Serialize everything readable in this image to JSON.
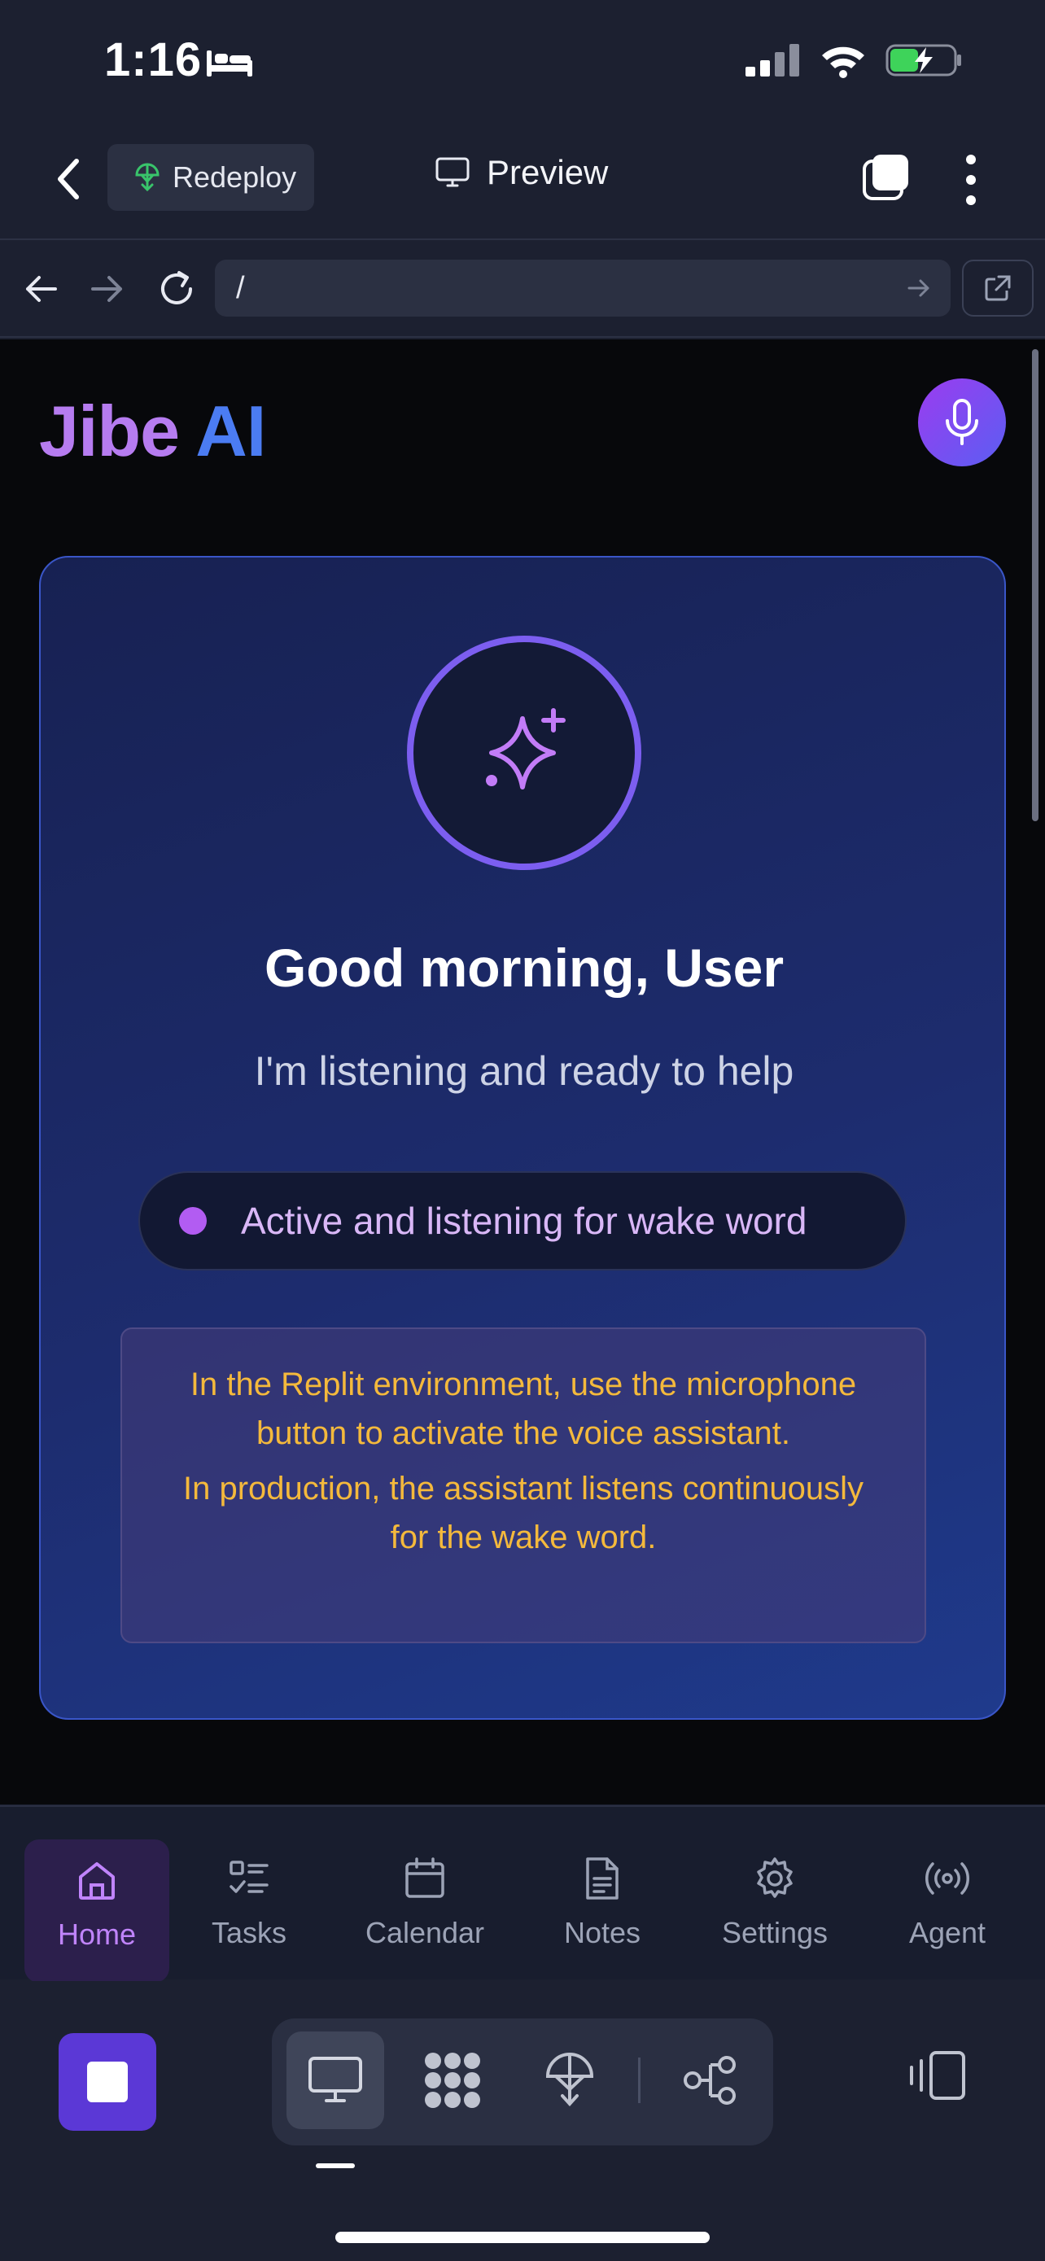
{
  "status_bar": {
    "time": "1:16"
  },
  "top_nav": {
    "redeploy_label": "Redeploy",
    "title": "Preview"
  },
  "url_bar": {
    "path": "/"
  },
  "app": {
    "logo_part1": "Jibe",
    "logo_part2": "AI",
    "greeting": "Good morning, User",
    "subtitle": "I'm listening and ready to help",
    "status_text": "Active and listening for wake word",
    "notice_line1": "In the Replit environment, use the microphone button to activate the voice assistant.",
    "notice_line2": "In production, the assistant listens continuously for the wake word."
  },
  "tabs": [
    {
      "label": "Home",
      "icon": "home-icon",
      "active": true
    },
    {
      "label": "Tasks",
      "icon": "tasks-icon",
      "active": false
    },
    {
      "label": "Calendar",
      "icon": "calendar-icon",
      "active": false
    },
    {
      "label": "Notes",
      "icon": "notes-icon",
      "active": false
    },
    {
      "label": "Settings",
      "icon": "gear-icon",
      "active": false
    },
    {
      "label": "Agent",
      "icon": "broadcast-icon",
      "active": false
    }
  ],
  "colors": {
    "accent_purple": "#b25cf2",
    "accent_blue": "#4b7cf2",
    "notice_text": "#f4b93c"
  }
}
